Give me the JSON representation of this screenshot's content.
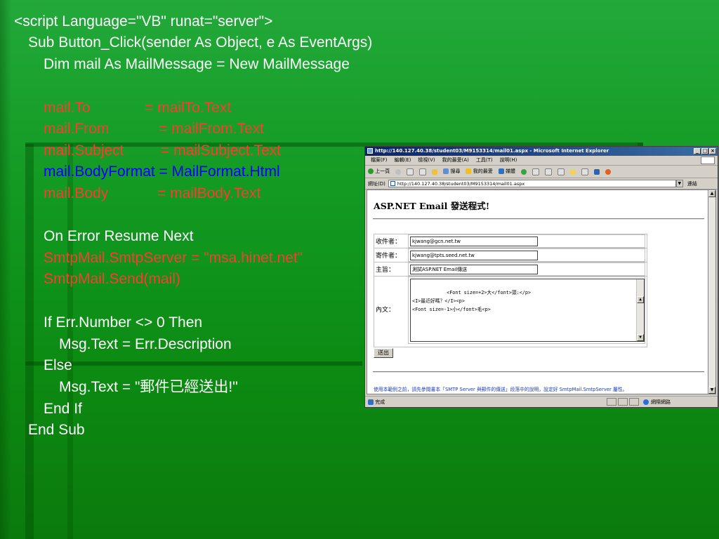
{
  "code": {
    "lines": [
      "<script Language=\"VB\" runat=\"server\">",
      "Sub Button_Click(sender As Object, e As EventArgs)",
      "Dim mail As MailMessage = New MailMessage",
      "mail.To",
      "= mailTo.Text",
      "mail.From",
      "= mailFrom.Text",
      "mail.Subject",
      "= mailSubject.Text",
      "mail.BodyFormat = MailFormat.Html",
      "mail.Body",
      "= mailBody.Text",
      "On Error Resume Next",
      "SmtpMail.SmtpServer = \"msa.hinet.net\"",
      "SmtpMail.Send(mail)",
      "If Err.Number <> 0 Then",
      "Msg.Text = Err.Description",
      "Else",
      "Msg.Text = \"郵件已經送出!\"",
      "End If",
      "End Sub"
    ],
    "colors": {
      "default": "#ffffff",
      "highlight": "#ff3b2f",
      "blue": "#0000ff"
    }
  },
  "browser": {
    "title": "http://140.127.40.38/student03/M9153314/mail01.aspx - Microsoft Internet Explorer",
    "menu": [
      "檔案(F)",
      "編輯(E)",
      "檢視(V)",
      "我的最愛(A)",
      "工具(T)",
      "說明(H)"
    ],
    "toolbar": [
      "上一頁",
      "搜尋",
      "我的最愛",
      "媒體"
    ],
    "address_label": "網址(D)",
    "address": "http://140.127.40.38/student03/M9153314/mail01.aspx",
    "go_label": "連結",
    "page_heading": "ASP.NET Email 發送程式!",
    "form": {
      "to_label": "收件者：",
      "to_value": "kjwang@gcn.net.tw",
      "from_label": "寄件者：",
      "from_value": "kjwang@tpts.seed.net.tw",
      "subject_label": "主旨：",
      "subject_value": "測試ASP.NET Email傳送",
      "body_label": "內文：",
      "body_value": "<Font size=+2>大</font>頭:</p>\n<I>最近好嗎？</I><p>\n<Font size=-1>小</font>毛<p>",
      "send_label": "送出"
    },
    "note": "使用本範例之前，請先參閱書本「SMTP Server 與郵件的傳送」段落中的說明，設定好 SmtpMail.SmtpServer 屬性。",
    "status_text": "完成",
    "zone_text": "網際網路"
  }
}
